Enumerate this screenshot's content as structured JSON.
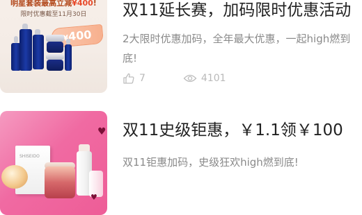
{
  "feed": {
    "items": [
      {
        "thumb": {
          "promo_prefix": "明星套装最高立减",
          "promo_amount": "¥400",
          "promo_suffix": "!",
          "deadline": "限时优惠截至11月30日",
          "price_currency": "¥",
          "price_value": "400"
        },
        "title": "双11延长赛，加码限时优惠活动",
        "description": "2大限时优惠加码，全年最大优惠，一起high燃到底!",
        "likes": "7",
        "views": "4101",
        "icons": {
          "likes": "thumbs-up-icon",
          "views": "eye-icon"
        }
      },
      {
        "thumb": {
          "box_label": "SHISEIDO"
        },
        "title": "双11史级钜惠，￥1.1领￥100",
        "description": "双11钜惠加码，史级狂欢high燃到底!"
      }
    ]
  },
  "colors": {
    "title": "#222222",
    "description": "#8a8a8a",
    "meta": "#b9b9b9",
    "promo_accent": "#e8492a",
    "thumb2_bg": "#f06aa2"
  }
}
